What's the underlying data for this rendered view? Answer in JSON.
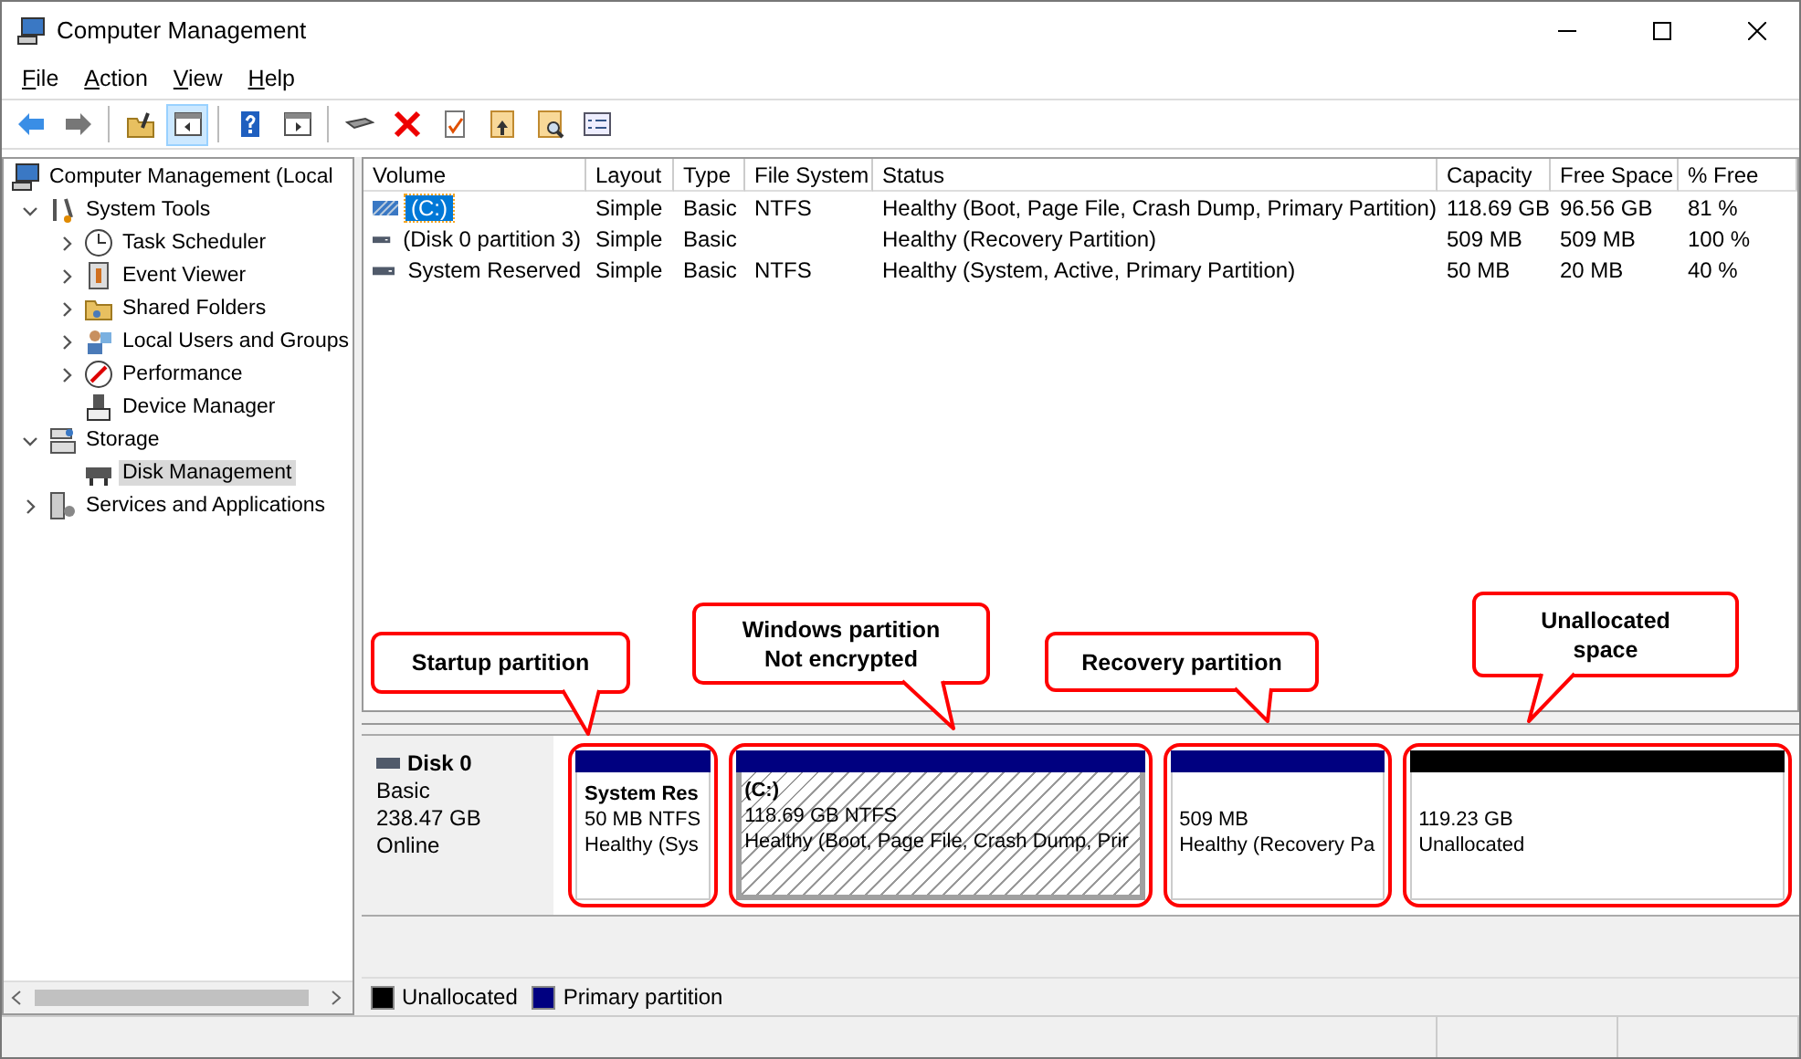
{
  "window": {
    "title": "Computer Management"
  },
  "menu": [
    {
      "label": "File"
    },
    {
      "label": "Action"
    },
    {
      "label": "View"
    },
    {
      "label": "Help"
    }
  ],
  "toolbar": [
    {
      "kind": "back",
      "pressed": false
    },
    {
      "kind": "forward",
      "pressed": false
    },
    {
      "kind": "up",
      "pressed": false
    },
    {
      "kind": "tree",
      "pressed": true
    },
    {
      "kind": "help",
      "pressed": false
    },
    {
      "kind": "pane",
      "pressed": false
    },
    {
      "kind": "disk",
      "pressed": false
    },
    {
      "kind": "delete",
      "pressed": false
    },
    {
      "kind": "check",
      "pressed": false
    },
    {
      "kind": "folder-up",
      "pressed": false
    },
    {
      "kind": "folder-search",
      "pressed": false
    },
    {
      "kind": "props",
      "pressed": false
    }
  ],
  "tree": [
    {
      "label": "Computer Management (Local",
      "selected": false,
      "children": [
        {
          "label": "System Tools",
          "expanded": true,
          "selected": false,
          "children": [
            {
              "label": "Task Scheduler",
              "expanded": false,
              "selected": false
            },
            {
              "label": "Event Viewer",
              "expanded": false,
              "selected": false
            },
            {
              "label": "Shared Folders",
              "expanded": false,
              "selected": false
            },
            {
              "label": "Local Users and Groups",
              "expanded": false,
              "selected": false
            },
            {
              "label": "Performance",
              "expanded": false,
              "selected": false
            },
            {
              "label": "Device Manager",
              "selected": false
            }
          ]
        },
        {
          "label": "Storage",
          "expanded": true,
          "selected": false,
          "children": [
            {
              "label": "Disk Management",
              "selected": true
            }
          ]
        },
        {
          "label": "Services and Applications",
          "expanded": false,
          "selected": false
        }
      ]
    }
  ],
  "table": {
    "columns": [
      "Volume",
      "Layout",
      "Type",
      "File System",
      "Status",
      "Capacity",
      "Free Space",
      "% Free"
    ],
    "rows": [
      {
        "kind": "striped",
        "selected": true,
        "cells": [
          "(C:)",
          "Simple",
          "Basic",
          "NTFS",
          "Healthy (Boot, Page File, Crash Dump, Primary Partition)",
          "118.69 GB",
          "96.56 GB",
          "81 %"
        ]
      },
      {
        "kind": "plain",
        "selected": false,
        "cells": [
          "(Disk 0 partition 3)",
          "Simple",
          "Basic",
          "",
          "Healthy (Recovery Partition)",
          "509 MB",
          "509 MB",
          "100 %"
        ]
      },
      {
        "kind": "plain",
        "selected": false,
        "cells": [
          "System Reserved",
          "Simple",
          "Basic",
          "NTFS",
          "Healthy (System, Active, Primary Partition)",
          "50 MB",
          "20 MB",
          "40 %"
        ]
      }
    ]
  },
  "disk": {
    "name": "Disk 0",
    "type": "Basic",
    "size": "238.47 GB",
    "status": "Online",
    "partitions": [
      {
        "kind": "primary",
        "selected": false,
        "circled": true,
        "title": "System Res",
        "size": "50 MB NTFS",
        "status": "Healthy (Sys"
      },
      {
        "kind": "primary",
        "selected": true,
        "circled": true,
        "title": "(C:)",
        "size": "118.69 GB NTFS",
        "status": "Healthy (Boot, Page File, Crash Dump, Prir"
      },
      {
        "kind": "primary",
        "selected": false,
        "circled": true,
        "size": "509 MB",
        "status": "Healthy (Recovery Pa"
      },
      {
        "kind": "unallocated",
        "selected": false,
        "circled": true,
        "size": "119.23 GB",
        "status": "Unallocated"
      }
    ]
  },
  "callouts": [
    "Startup partition",
    "Windows partition\nNot encrypted",
    "Recovery partition",
    "Unallocated\nspace"
  ],
  "legend": [
    {
      "label": "Unallocated",
      "color": "#000000"
    },
    {
      "label": "Primary partition",
      "color": "#000080"
    }
  ]
}
